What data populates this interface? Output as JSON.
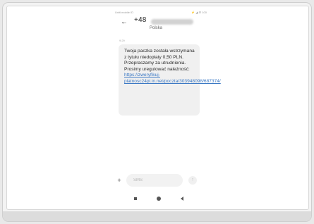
{
  "status_bar": {
    "carrier": "Uniti mobile ID",
    "indicators": "⚡ ◢ ☰ 100"
  },
  "header": {
    "back_icon": "arrow-left-icon",
    "sender_number": "+48",
    "sender_subtitle": "Polska"
  },
  "message": {
    "time": "9:29",
    "text": "Twoja paczka została wstrzymana z tytułu niedopłaty 0,50 PLN. Przepraszamy za utrudnienia. Prosimy uregulować należność:",
    "link": "https://zweryfikuj-platnosc24pl.in.net/poczta/303948098/687374/"
  },
  "compose": {
    "add_icon": "plus-icon",
    "placeholder": "SMS",
    "send_icon": "arrow-up-icon"
  },
  "nav": {
    "recents_icon": "square-icon",
    "home_icon": "circle-icon",
    "back_icon": "triangle-back-icon"
  },
  "colors": {
    "link": "#3a78c4",
    "bubble": "#f0f0f0"
  }
}
